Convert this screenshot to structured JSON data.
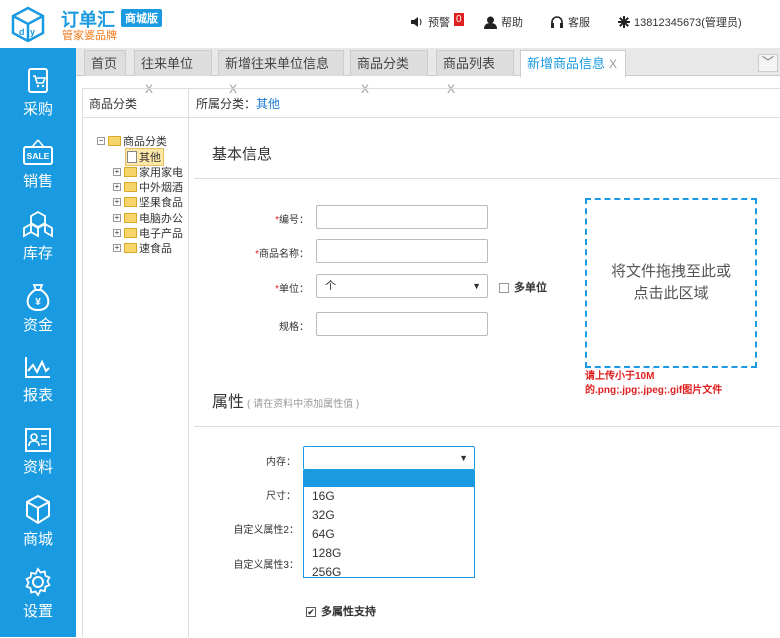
{
  "header": {
    "brand": "订单汇",
    "edition": "商城版",
    "slogan": "管家婆品牌",
    "alert_label": "预警",
    "alert_count": "0",
    "help_label": "帮助",
    "service_label": "客服",
    "user_label": "13812345673(管理员)"
  },
  "sidebar": {
    "items": [
      {
        "label": "采购",
        "icon": "cart-icon"
      },
      {
        "label": "销售",
        "icon": "sale-icon"
      },
      {
        "label": "库存",
        "icon": "boxes-icon"
      },
      {
        "label": "资金",
        "icon": "money-bag-icon"
      },
      {
        "label": "报表",
        "icon": "chart-icon"
      },
      {
        "label": "资料",
        "icon": "contact-card-icon"
      },
      {
        "label": "商城",
        "icon": "store-icon"
      },
      {
        "label": "设置",
        "icon": "gear-icon"
      }
    ]
  },
  "tabs": [
    {
      "label": "首页",
      "closable": false
    },
    {
      "label": "往来单位",
      "closable": true
    },
    {
      "label": "新增往来单位信息",
      "closable": true
    },
    {
      "label": "商品分类",
      "closable": true
    },
    {
      "label": "商品列表",
      "closable": true
    },
    {
      "label": "新增商品信息",
      "closable": true,
      "active": true
    }
  ],
  "tab_close": "X",
  "tab_more": "﹀",
  "left_panel": {
    "title": "商品分类",
    "tree": {
      "root": "商品分类",
      "selected": "其他",
      "children": [
        "家用家电",
        "中外烟酒",
        "坚果食品",
        "电脑办公",
        "电子产品",
        "速食品"
      ]
    }
  },
  "form": {
    "category_label": "所属分类：",
    "category_value": "其他",
    "basic_title": "基本信息",
    "code_label": "编号：",
    "name_label": "商品名称：",
    "unit_label": "单位：",
    "unit_value": "个",
    "multi_unit_label": "多单位",
    "spec_label": "规格：",
    "upload_text": "将文件拖拽至此或点击此区域",
    "upload_hint_1": "请上传小于10M",
    "upload_hint_2": "的.png;.jpg;.jpeg;.gif图片文件",
    "attr_title": "属性",
    "attr_hint": "( 请在资料中添加属性值 )",
    "memory_label": "内存：",
    "memory_value": "",
    "memory_options": [
      "",
      "16G",
      "32G",
      "64G",
      "128G",
      "256G"
    ],
    "size_label": "尺寸：",
    "custom2_label": "自定义属性2：",
    "custom3_label": "自定义属性3：",
    "multi_attr_label": "多属性支持",
    "multi_attr_checked": true
  },
  "colors": {
    "accent": "#1a9ae0",
    "brand_orange": "#f07a1a",
    "required_red": "#e02020"
  }
}
